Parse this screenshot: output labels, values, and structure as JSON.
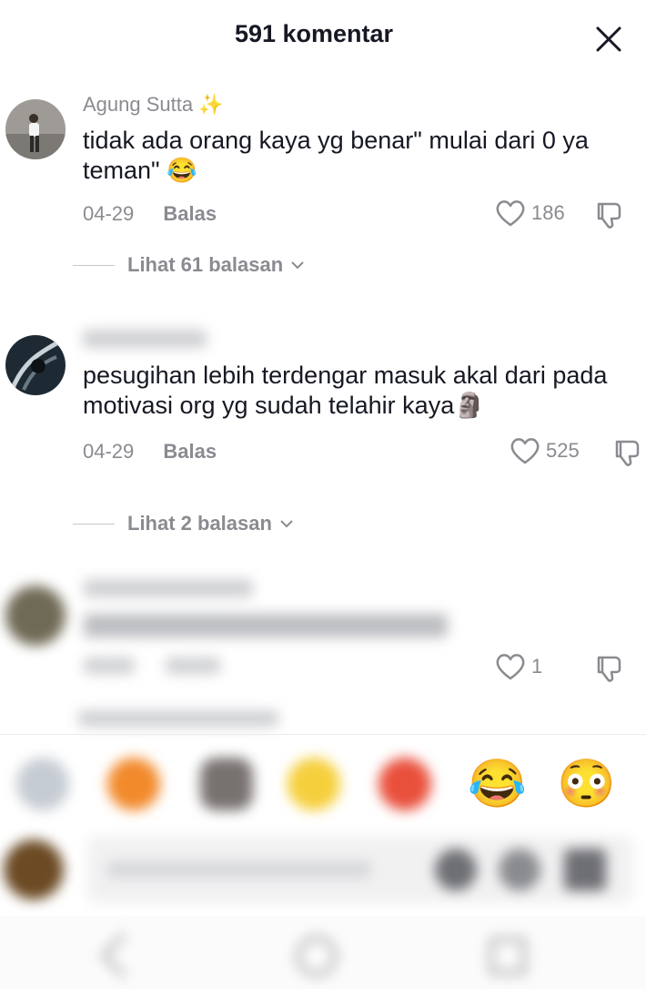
{
  "header": {
    "title": "591 komentar"
  },
  "comments": [
    {
      "username": "Agung Sutta",
      "username_emoji": "✨",
      "text": "tidak ada orang kaya yg benar\" mulai dari 0 ya teman\" 😂",
      "date": "04-29",
      "reply_label": "Balas",
      "likes": "186",
      "view_replies": "Lihat 61 balasan"
    },
    {
      "username": "",
      "text": "pesugihan lebih terdengar masuk akal dari pada motivasi org yg sudah telahir kaya🗿",
      "date": "04-29",
      "reply_label": "Balas",
      "likes": "525",
      "view_replies": "Lihat 2 balasan"
    },
    {
      "likes": "1"
    }
  ],
  "emoji_bar": [
    "😂",
    "😳"
  ],
  "colors": {
    "muted": "#8a8b91",
    "text": "#161823",
    "accent": "#fe2c55"
  }
}
